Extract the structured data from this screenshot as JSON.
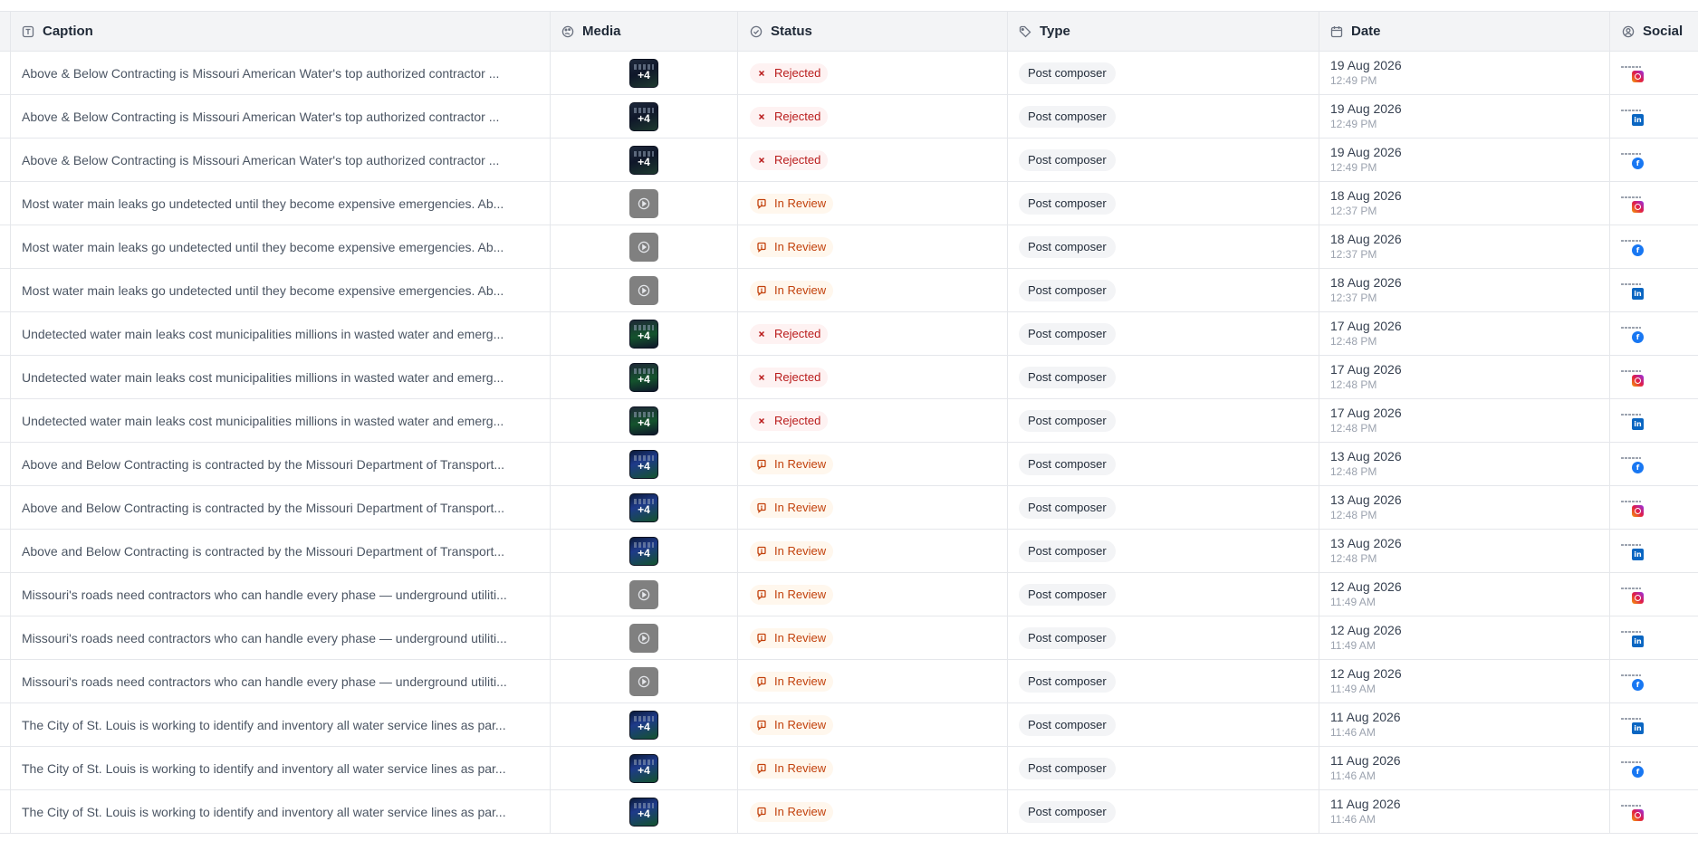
{
  "columns": {
    "caption": "Caption",
    "media": "Media",
    "status": "Status",
    "type": "Type",
    "date": "Date",
    "social": "Social"
  },
  "icons": {
    "caption": "text-field-icon",
    "media": "palette-icon",
    "status": "check-circle-icon",
    "type": "tag-icon",
    "date": "calendar-icon",
    "social": "user-circle-icon"
  },
  "colors": {
    "rejected": "#b91c1c",
    "in_review": "#c2410c"
  },
  "rows": [
    {
      "caption": "Above & Below Contracting is Missouri American Water's top authorized contractor ...",
      "media": {
        "kind": "image",
        "count": "+4",
        "tone": "dark"
      },
      "status": "Rejected",
      "status_kind": "rejected",
      "type": "Post composer",
      "date": "19 Aug 2026",
      "time": "12:49 PM",
      "social": "instagram"
    },
    {
      "caption": "Above & Below Contracting is Missouri American Water's top authorized contractor ...",
      "media": {
        "kind": "image",
        "count": "+4",
        "tone": "dark"
      },
      "status": "Rejected",
      "status_kind": "rejected",
      "type": "Post composer",
      "date": "19 Aug 2026",
      "time": "12:49 PM",
      "social": "linkedin"
    },
    {
      "caption": "Above & Below Contracting is Missouri American Water's top authorized contractor ...",
      "media": {
        "kind": "image",
        "count": "+4",
        "tone": "dark"
      },
      "status": "Rejected",
      "status_kind": "rejected",
      "type": "Post composer",
      "date": "19 Aug 2026",
      "time": "12:49 PM",
      "social": "facebook"
    },
    {
      "caption": "Most water main leaks go undetected until they become expensive emergencies. Ab...",
      "media": {
        "kind": "video",
        "count": "",
        "tone": "gray"
      },
      "status": "In Review",
      "status_kind": "review",
      "type": "Post composer",
      "date": "18 Aug 2026",
      "time": "12:37 PM",
      "social": "instagram"
    },
    {
      "caption": "Most water main leaks go undetected until they become expensive emergencies. Ab...",
      "media": {
        "kind": "video",
        "count": "",
        "tone": "gray"
      },
      "status": "In Review",
      "status_kind": "review",
      "type": "Post composer",
      "date": "18 Aug 2026",
      "time": "12:37 PM",
      "social": "facebook"
    },
    {
      "caption": "Most water main leaks go undetected until they become expensive emergencies. Ab...",
      "media": {
        "kind": "video",
        "count": "",
        "tone": "gray"
      },
      "status": "In Review",
      "status_kind": "review",
      "type": "Post composer",
      "date": "18 Aug 2026",
      "time": "12:37 PM",
      "social": "linkedin"
    },
    {
      "caption": "Undetected water main leaks cost municipalities millions in wasted water and emerg...",
      "media": {
        "kind": "image",
        "count": "+4",
        "tone": "green"
      },
      "status": "Rejected",
      "status_kind": "rejected",
      "type": "Post composer",
      "date": "17 Aug 2026",
      "time": "12:48 PM",
      "social": "facebook"
    },
    {
      "caption": "Undetected water main leaks cost municipalities millions in wasted water and emerg...",
      "media": {
        "kind": "image",
        "count": "+4",
        "tone": "green"
      },
      "status": "Rejected",
      "status_kind": "rejected",
      "type": "Post composer",
      "date": "17 Aug 2026",
      "time": "12:48 PM",
      "social": "instagram"
    },
    {
      "caption": "Undetected water main leaks cost municipalities millions in wasted water and emerg...",
      "media": {
        "kind": "image",
        "count": "+4",
        "tone": "green"
      },
      "status": "Rejected",
      "status_kind": "rejected",
      "type": "Post composer",
      "date": "17 Aug 2026",
      "time": "12:48 PM",
      "social": "linkedin"
    },
    {
      "caption": "Above and Below Contracting is contracted by the Missouri Department of Transport...",
      "media": {
        "kind": "image",
        "count": "+4",
        "tone": "blue"
      },
      "status": "In Review",
      "status_kind": "review",
      "type": "Post composer",
      "date": "13 Aug 2026",
      "time": "12:48 PM",
      "social": "facebook"
    },
    {
      "caption": "Above and Below Contracting is contracted by the Missouri Department of Transport...",
      "media": {
        "kind": "image",
        "count": "+4",
        "tone": "blue"
      },
      "status": "In Review",
      "status_kind": "review",
      "type": "Post composer",
      "date": "13 Aug 2026",
      "time": "12:48 PM",
      "social": "instagram"
    },
    {
      "caption": "Above and Below Contracting is contracted by the Missouri Department of Transport...",
      "media": {
        "kind": "image",
        "count": "+4",
        "tone": "blue"
      },
      "status": "In Review",
      "status_kind": "review",
      "type": "Post composer",
      "date": "13 Aug 2026",
      "time": "12:48 PM",
      "social": "linkedin"
    },
    {
      "caption": "Missouri's roads need contractors who can handle every phase — underground utiliti...",
      "media": {
        "kind": "video",
        "count": "",
        "tone": "gray"
      },
      "status": "In Review",
      "status_kind": "review",
      "type": "Post composer",
      "date": "12 Aug 2026",
      "time": "11:49 AM",
      "social": "instagram"
    },
    {
      "caption": "Missouri's roads need contractors who can handle every phase — underground utiliti...",
      "media": {
        "kind": "video",
        "count": "",
        "tone": "gray"
      },
      "status": "In Review",
      "status_kind": "review",
      "type": "Post composer",
      "date": "12 Aug 2026",
      "time": "11:49 AM",
      "social": "linkedin"
    },
    {
      "caption": "Missouri's roads need contractors who can handle every phase — underground utiliti...",
      "media": {
        "kind": "video",
        "count": "",
        "tone": "gray"
      },
      "status": "In Review",
      "status_kind": "review",
      "type": "Post composer",
      "date": "12 Aug 2026",
      "time": "11:49 AM",
      "social": "facebook"
    },
    {
      "caption": "The City of St. Louis is working to identify and inventory all water service lines as par...",
      "media": {
        "kind": "image",
        "count": "+4",
        "tone": "blue"
      },
      "status": "In Review",
      "status_kind": "review",
      "type": "Post composer",
      "date": "11 Aug 2026",
      "time": "11:46 AM",
      "social": "linkedin"
    },
    {
      "caption": "The City of St. Louis is working to identify and inventory all water service lines as par...",
      "media": {
        "kind": "image",
        "count": "+4",
        "tone": "blue"
      },
      "status": "In Review",
      "status_kind": "review",
      "type": "Post composer",
      "date": "11 Aug 2026",
      "time": "11:46 AM",
      "social": "facebook"
    },
    {
      "caption": "The City of St. Louis is working to identify and inventory all water service lines as par...",
      "media": {
        "kind": "image",
        "count": "+4",
        "tone": "blue"
      },
      "status": "In Review",
      "status_kind": "review",
      "type": "Post composer",
      "date": "11 Aug 2026",
      "time": "11:46 AM",
      "social": "instagram"
    }
  ]
}
